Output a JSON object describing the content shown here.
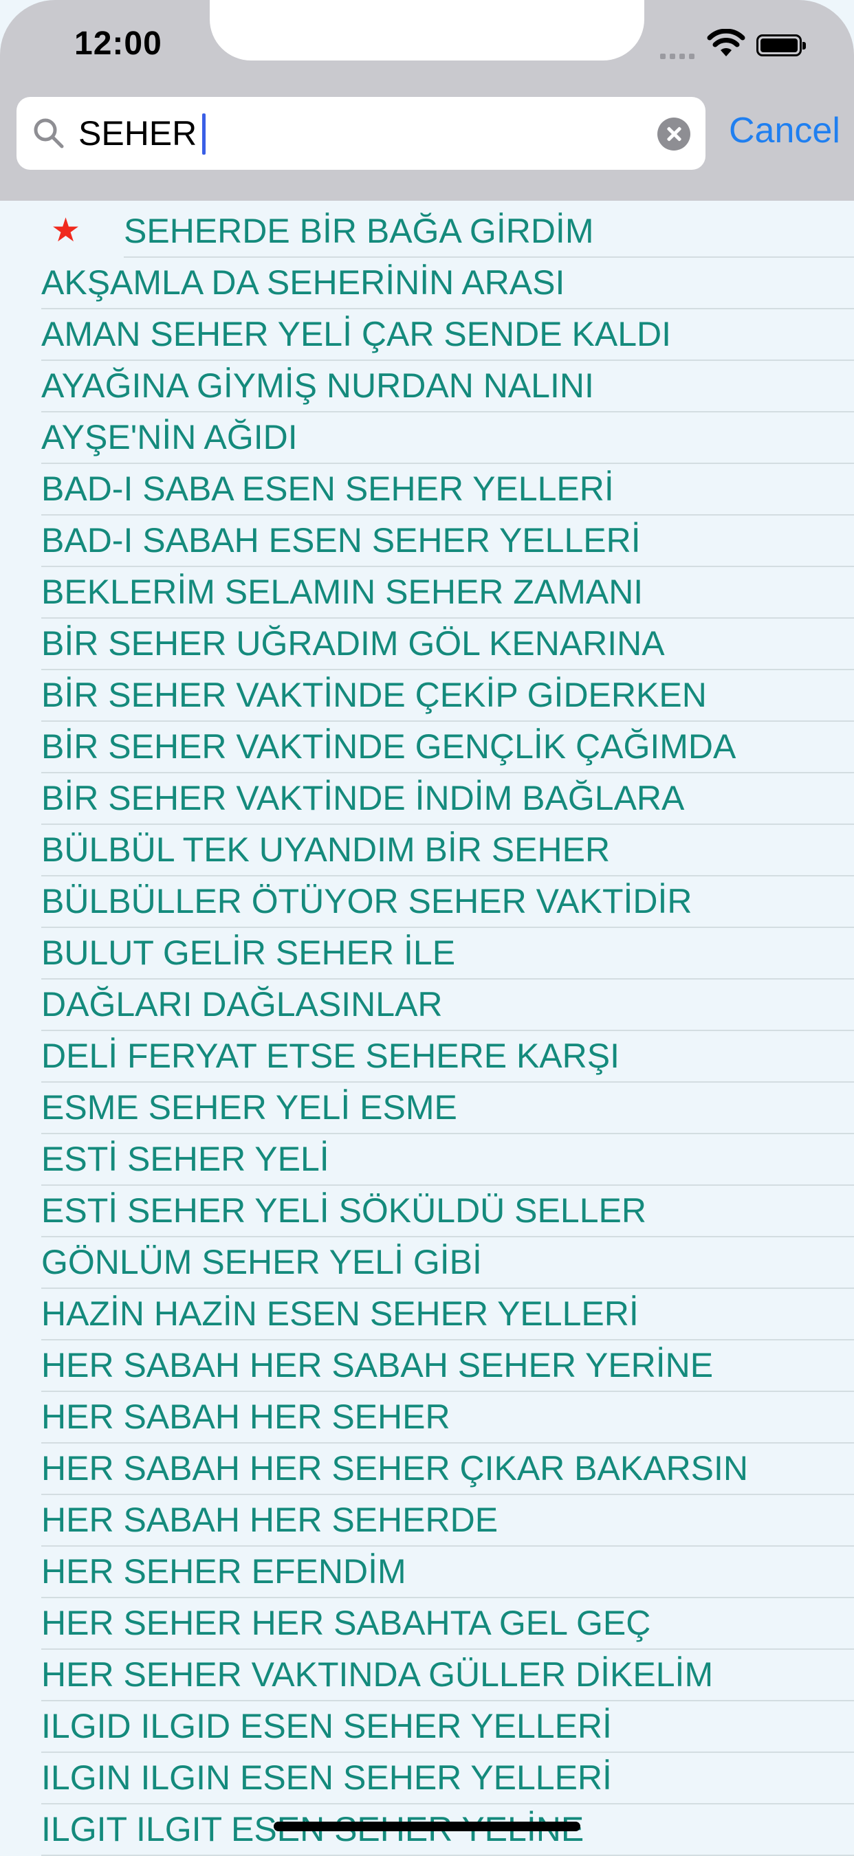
{
  "status_bar": {
    "time": "12:00"
  },
  "search": {
    "value": "SEHER",
    "cancel_label": "Cancel"
  },
  "results": {
    "featured": "SEHERDE BİR BAĞA GİRDİM",
    "items": [
      "AKŞAMLA DA SEHERİNİN ARASI",
      "AMAN SEHER YELİ ÇAR SENDE KALDI",
      "AYAĞINA GİYMİŞ NURDAN NALINI",
      "AYŞE'NİN AĞIDI",
      "BAD-I SABA ESEN SEHER YELLERİ",
      "BAD-I SABAH ESEN SEHER YELLERİ",
      "BEKLERİM SELAMIN SEHER ZAMANI",
      "BİR SEHER UĞRADIM GÖL KENARINA",
      "BİR SEHER VAKTİNDE ÇEKİP GİDERKEN",
      "BİR SEHER VAKTİNDE GENÇLİK ÇAĞIMDA",
      "BİR SEHER VAKTİNDE İNDİM BAĞLARA",
      "BÜLBÜL TEK UYANDIM BİR SEHER",
      "BÜLBÜLLER ÖTÜYOR SEHER VAKTİDİR",
      "BULUT GELİR SEHER İLE",
      "DAĞLARI DAĞLASINLAR",
      "DELİ FERYAT ETSE SEHERE KARŞI",
      "ESME SEHER YELİ ESME",
      "ESTİ SEHER YELİ",
      "ESTİ SEHER YELİ SÖKÜLDÜ SELLER",
      "GÖNLÜM SEHER YELİ GİBİ",
      "HAZİN HAZİN ESEN SEHER YELLERİ",
      "HER SABAH HER SABAH SEHER YERİNE",
      "HER SABAH HER SEHER",
      "HER SABAH HER SEHER ÇIKAR BAKARSIN",
      "HER SABAH HER SEHERDE",
      "HER SEHER EFENDİM",
      "HER SEHER HER SABAHTA GEL GEÇ",
      "HER SEHER VAKTINDA GÜLLER DİKELİM",
      "ILGID ILGID ESEN SEHER YELLERİ",
      "ILGIN ILGIN ESEN SEHER YELLERİ",
      "ILGIT ILGIT ESEN SEHER YELİNE"
    ]
  },
  "colors": {
    "accent": "#1f7ff0",
    "item_text": "#148a7c",
    "star": "#f02a1e"
  }
}
